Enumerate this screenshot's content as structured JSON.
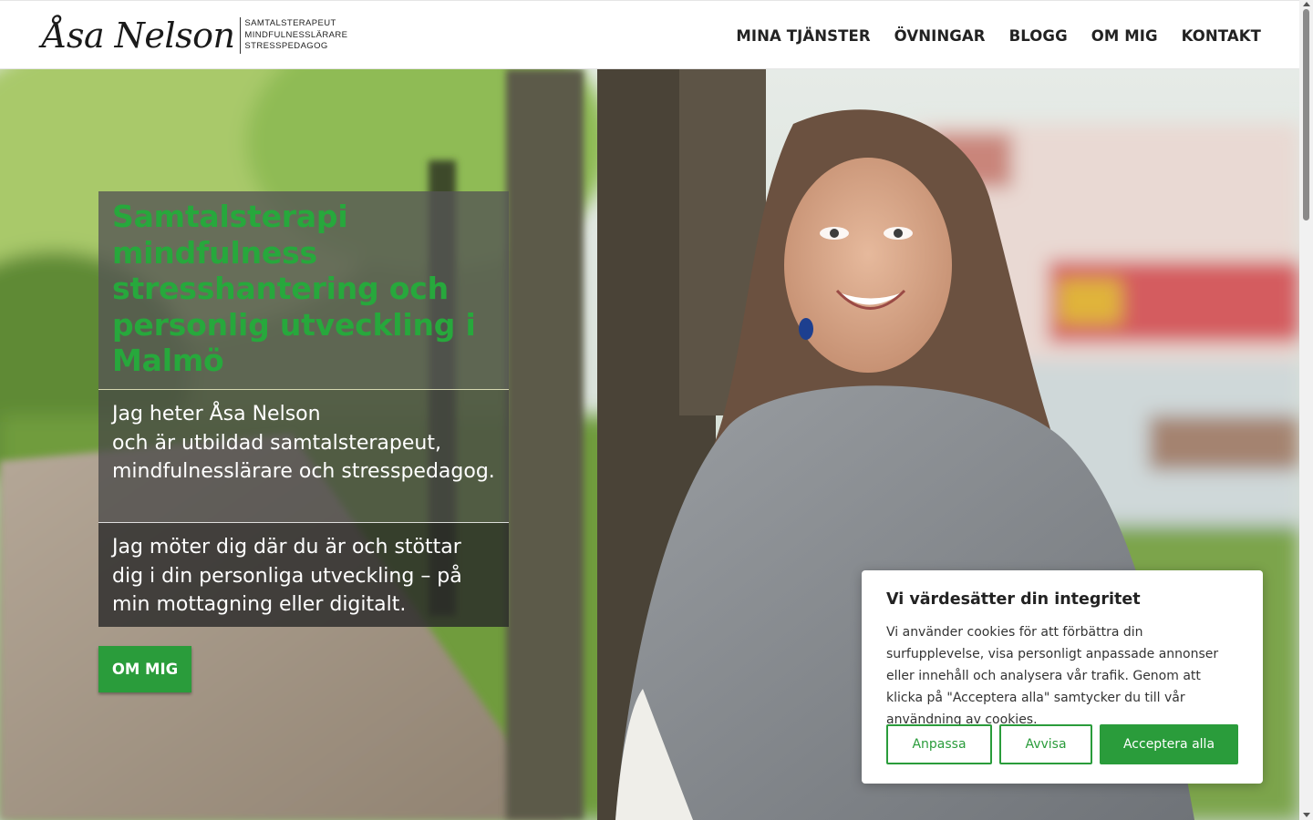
{
  "header": {
    "logo": {
      "name": "Åsa Nelson",
      "taglines": [
        "SAMTALSTERAPEUT",
        "MINDFULNESSLÄRARE",
        "STRESSPEDAGOG"
      ]
    },
    "nav": [
      "MINA TJÄNSTER",
      "ÖVNINGAR",
      "BLOGG",
      "OM MIG",
      "KONTAKT"
    ]
  },
  "hero": {
    "photo": "woman-in-grey-shawl-smiling-in-park-photo",
    "headline": "Samtalsterapi mindfulness stresshantering och personlig utveckling i Malmö",
    "intro": "Jag heter Åsa Nelson\noch är utbildad samtalsterapeut, mindfulnesslärare och stresspedagog.",
    "meet": "Jag möter dig där du är och stöttar dig i din personliga utveckling – på min mottagning eller digitalt.",
    "button": "OM MIG"
  },
  "cookie_banner": {
    "title": "Vi värdesätter din integritet",
    "text": "Vi använder cookies för att förbättra din surfupplevelse, visa personligt anpassade annonser eller innehåll och analysera vår trafik. Genom att klicka på \"Acceptera alla\" samtycker du till vår användning av cookies.",
    "buttons": {
      "customize": "Anpassa",
      "reject": "Avvisa",
      "accept": "Acceptera alla"
    }
  },
  "colors": {
    "accent": "#2a9c3b",
    "headline": "#27a83c",
    "nav_text": "#222222"
  }
}
